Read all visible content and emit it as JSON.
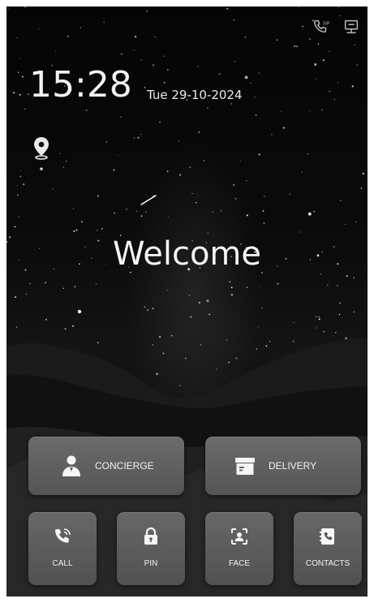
{
  "status_bar": {
    "icons": [
      "sip-phone-icon",
      "network-icon"
    ]
  },
  "clock": {
    "time": "15:28",
    "date": "Tue 29-10-2024"
  },
  "location_icon": "location-pin-icon",
  "welcome_text": "Welcome",
  "actions": {
    "concierge": {
      "label": "CONCIERGE",
      "icon": "person-icon"
    },
    "delivery": {
      "label": "DELIVERY",
      "icon": "package-icon"
    }
  },
  "quick_actions": [
    {
      "label": "CALL",
      "icon": "phone-icon"
    },
    {
      "label": "PIN",
      "icon": "lock-icon"
    },
    {
      "label": "FACE",
      "icon": "face-scan-icon"
    },
    {
      "label": "CONTACTS",
      "icon": "contacts-book-icon"
    }
  ],
  "colors": {
    "background": "#0b0b0b",
    "button": "#5e5e5e",
    "text": "#f2f2f2"
  }
}
